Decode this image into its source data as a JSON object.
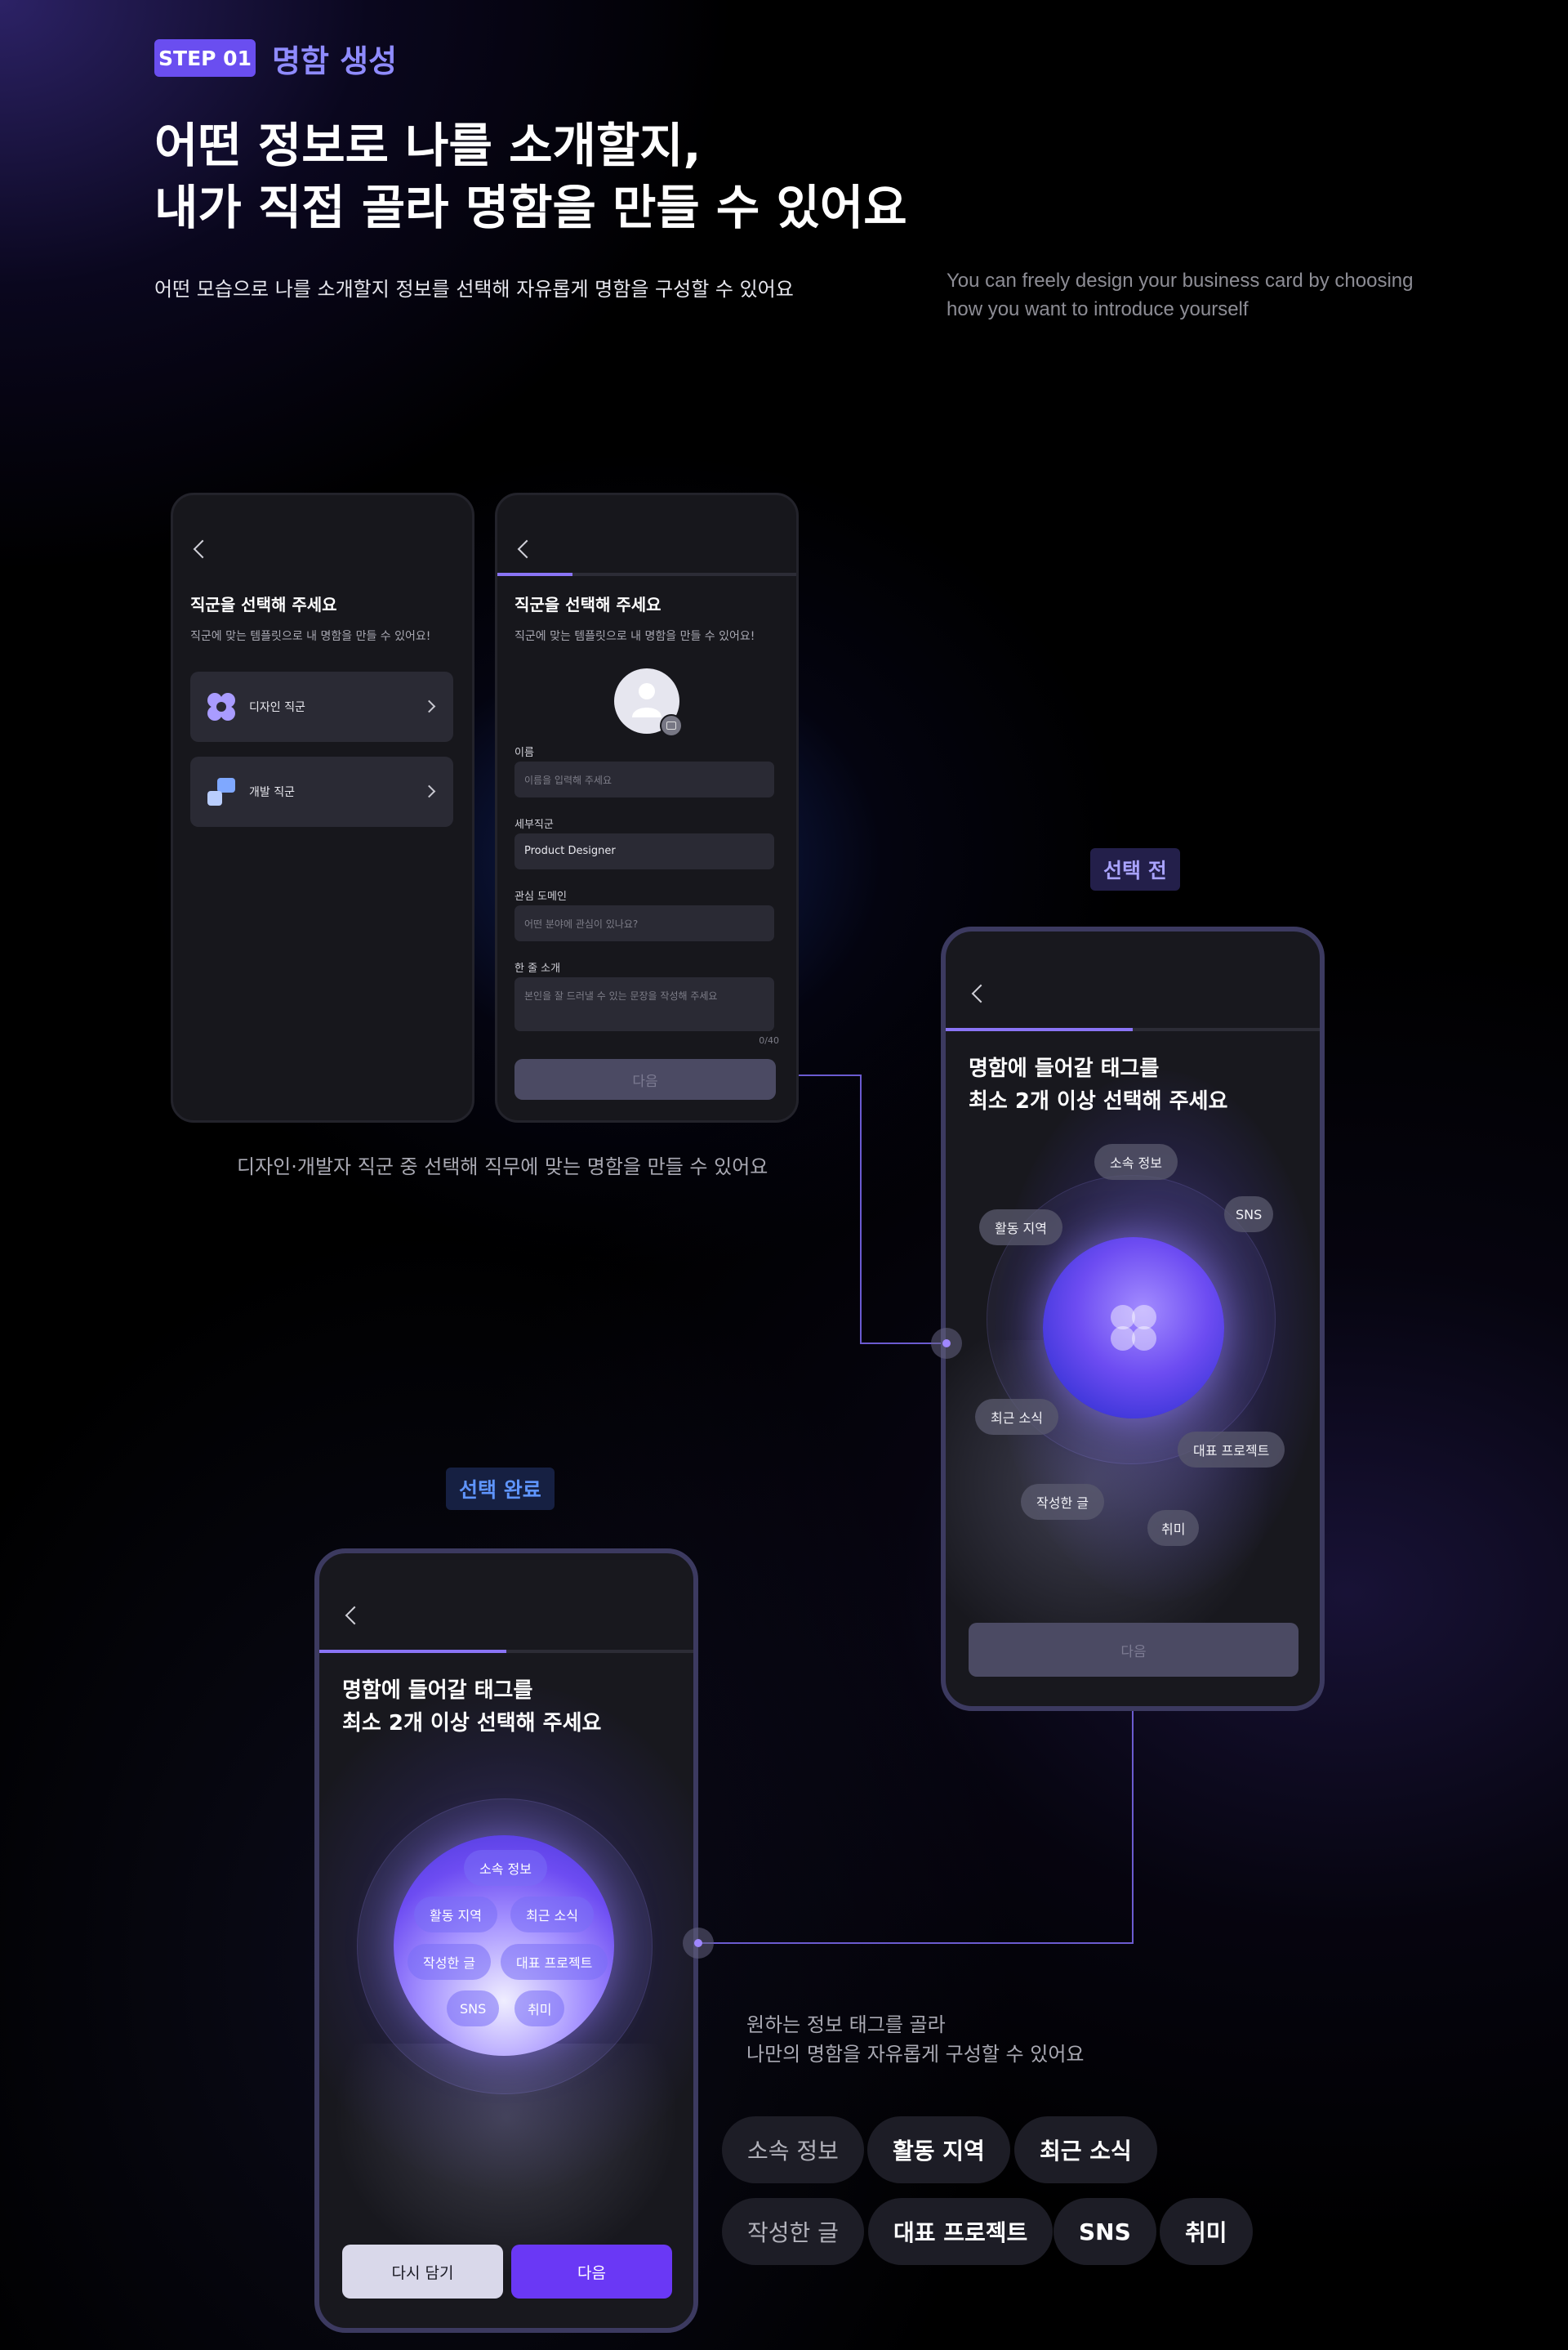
{
  "header": {
    "step_badge": "STEP 01",
    "step_title": "명함 생성",
    "headline_line1": "어떤 정보로 나를 소개할지,",
    "headline_line2": "내가 직접 골라 명함을 만들 수 있어요",
    "sub_ko": "어떤 모습으로 나를 소개할지 정보를 선택해 자유롭게 명함을 구성할 수 있어요",
    "sub_en": "You can freely design your business card by choosing how you want to introduce yourself"
  },
  "phone_job": {
    "title": "직군을 선택해 주세요",
    "subtitle": "직군에 맞는 템플릿으로 내 명함을 만들 수 있어요!",
    "items": [
      {
        "label": "디자인 직군",
        "icon": "flower-icon"
      },
      {
        "label": "개발 직군",
        "icon": "blocks-icon"
      }
    ]
  },
  "phone_form": {
    "title": "직군을 선택해 주세요",
    "subtitle": "직군에 맞는 템플릿으로 내 명함을 만들 수 있어요!",
    "progress": 0.25,
    "fields": {
      "name_label": "이름",
      "name_placeholder": "이름을 입력해 주세요",
      "role_label": "세부직군",
      "role_value": "Product Designer",
      "domain_label": "관심 도메인",
      "domain_placeholder": "어떤 분야에 관심이 있나요?",
      "intro_label": "한 줄 소개",
      "intro_placeholder": "본인을 잘 드러낼 수 있는 문장을 작성해 주세요",
      "intro_count": "0/40"
    },
    "next_label": "다음"
  },
  "caption_job": "디자인·개발자 직군 중 선택해 직무에 맞는 명함을 만들 수 있어요",
  "before": {
    "badge": "선택 전",
    "title_line1": "명함에 들어갈 태그를",
    "title_line2": "최소 2개 이상 선택해 주세요",
    "progress": 0.5,
    "tags": {
      "affiliation": "소속 정보",
      "sns": "SNS",
      "region": "활동 지역",
      "news": "최근 소식",
      "project": "대표 프로젝트",
      "posts": "작성한 글",
      "hobby": "취미"
    },
    "next_label": "다음"
  },
  "after": {
    "badge": "선택 완료",
    "title_line1": "명함에 들어갈 태그를",
    "title_line2": "최소 2개 이상 선택해 주세요",
    "progress": 0.5,
    "tags": {
      "affiliation": "소속 정보",
      "region": "활동 지역",
      "news": "최근 소식",
      "posts": "작성한 글",
      "project": "대표 프로젝트",
      "sns": "SNS",
      "hobby": "취미"
    },
    "retry_label": "다시 담기",
    "next_label": "다음"
  },
  "caption_tags_line1": "원하는 정보 태그를 골라",
  "caption_tags_line2": "나만의 명함을 자유롭게 구성할 수 있어요",
  "tag_list": [
    "소속 정보",
    "활동 지역",
    "최근 소식",
    "작성한 글",
    "대표 프로젝트",
    "SNS",
    "취미"
  ],
  "colors": {
    "accent": "#6a4ef0",
    "accent_text": "#8f8bff",
    "blue_text": "#5f95ff",
    "background": "#000000"
  }
}
